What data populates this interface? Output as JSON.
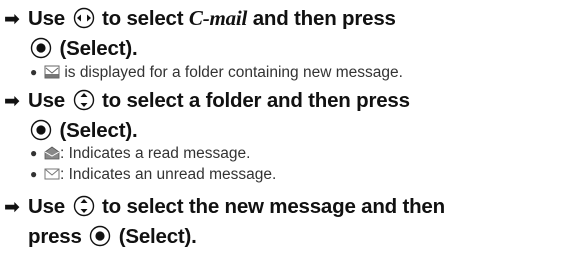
{
  "steps": [
    {
      "arrow": "➡",
      "pre": "Use",
      "key_icon": "left-right-nav-key-icon",
      "mid": "to select",
      "keyword": "C-mail",
      "post": "and then press",
      "line2_post": "(Select).",
      "select_icon": "center-select-key-icon",
      "notes": [
        {
          "icon": "new-message-folder-icon",
          "text": "is displayed for a folder containing new message."
        }
      ]
    },
    {
      "arrow": "➡",
      "pre": "Use",
      "key_icon": "up-down-nav-key-icon",
      "mid": "to select a folder and then press",
      "line2_post": "(Select).",
      "select_icon": "center-select-key-icon",
      "notes": [
        {
          "icon": "read-message-icon",
          "text": ": Indicates a read message."
        },
        {
          "icon": "unread-message-icon",
          "text": ": Indicates an unread message."
        }
      ]
    },
    {
      "arrow": "➡",
      "pre": "Use",
      "key_icon": "up-down-nav-key-icon",
      "mid": "to select the new message and then",
      "line2_pre": "press",
      "line2_post": "(Select).",
      "select_icon": "center-select-key-icon"
    }
  ]
}
